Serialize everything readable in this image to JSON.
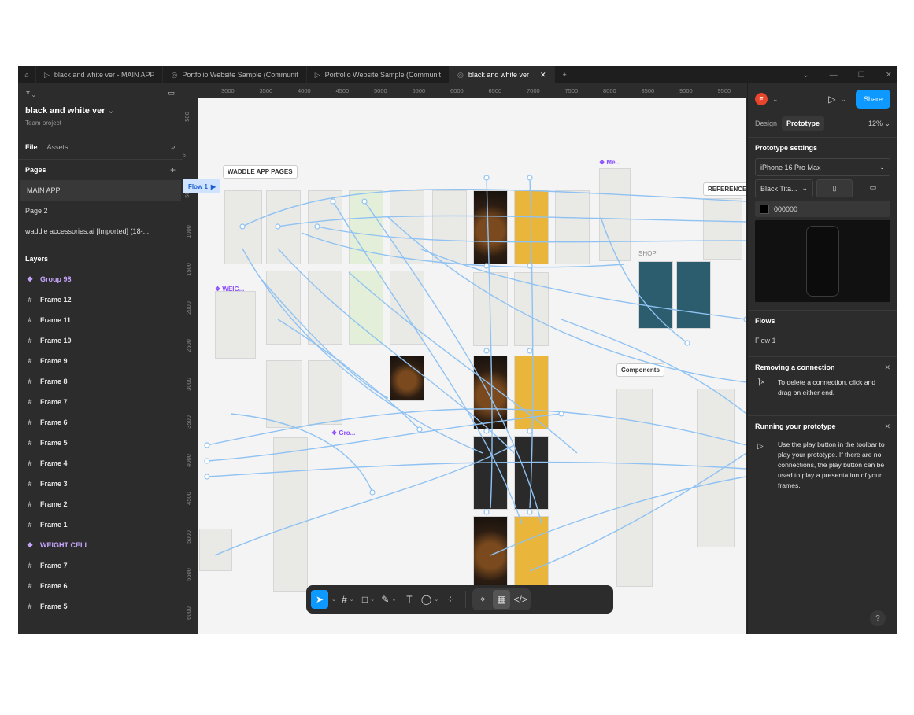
{
  "tabs": [
    {
      "label": "black and white ver - MAIN APP",
      "icon": "play-icon"
    },
    {
      "label": "Portfolio Website Sample (Communit",
      "icon": "figma-icon"
    },
    {
      "label": "Portfolio Website Sample (Communit",
      "icon": "play-icon"
    },
    {
      "label": "black and white ver",
      "icon": "figma-icon",
      "active": true
    }
  ],
  "left_panel": {
    "project_name": "black and white ver",
    "project_team": "Team project",
    "tab_file": "File",
    "tab_assets": "Assets",
    "pages_title": "Pages",
    "pages": [
      "MAIN APP",
      "Page 2",
      "waddle accessories.ai [Imported] (18-..."
    ],
    "layers_title": "Layers",
    "layers": [
      {
        "name": "Group 98",
        "type": "component"
      },
      {
        "name": "Frame 12",
        "type": "frame"
      },
      {
        "name": "Frame 11",
        "type": "frame"
      },
      {
        "name": "Frame 10",
        "type": "frame"
      },
      {
        "name": "Frame 9",
        "type": "frame"
      },
      {
        "name": "Frame 8",
        "type": "frame"
      },
      {
        "name": "Frame 7",
        "type": "frame"
      },
      {
        "name": "Frame 6",
        "type": "frame"
      },
      {
        "name": "Frame 5",
        "type": "frame"
      },
      {
        "name": "Frame 4",
        "type": "frame"
      },
      {
        "name": "Frame 3",
        "type": "frame"
      },
      {
        "name": "Frame 2",
        "type": "frame"
      },
      {
        "name": "Frame 1",
        "type": "frame"
      },
      {
        "name": "WEIGHT CELL",
        "type": "component"
      },
      {
        "name": "Frame 7",
        "type": "frame"
      },
      {
        "name": "Frame 6",
        "type": "frame"
      },
      {
        "name": "Frame 5",
        "type": "frame"
      }
    ]
  },
  "canvas": {
    "ruler_top": [
      "3000",
      "3500",
      "4000",
      "4500",
      "5000",
      "5500",
      "6000",
      "6500",
      "7000",
      "7500",
      "8000",
      "8500",
      "9000",
      "9500"
    ],
    "ruler_left": [
      "500",
      "0",
      "500",
      "1000",
      "1500",
      "2000",
      "2500",
      "3000",
      "3500",
      "4000",
      "4500",
      "5000",
      "5500",
      "6000"
    ],
    "labels": {
      "waddle_pages": "WADDLE APP PAGES",
      "reference": "REFERENCE",
      "components": "Components",
      "shop": "SHOP",
      "weight": "WEIG...",
      "group": "Gro...",
      "me": "Me..."
    },
    "flow_tag": "Flow 1"
  },
  "toolbar": {
    "tools": [
      "move-tool",
      "frame-tool",
      "shape-tool",
      "pen-tool",
      "text-tool",
      "comment-tool",
      "actions-tool"
    ],
    "text_glyph": "T"
  },
  "right_panel": {
    "avatar_letter": "E",
    "share_label": "Share",
    "tab_design": "Design",
    "tab_prototype": "Prototype",
    "zoom": "12%",
    "proto_settings_title": "Prototype settings",
    "device": "iPhone 16 Pro Max",
    "color_model": "Black Tita...",
    "bg_color": "000000",
    "flows_title": "Flows",
    "flow_item": "Flow 1",
    "remove_title": "Removing a connection",
    "remove_text": "To delete a connection, click and drag on either end.",
    "run_title": "Running your prototype",
    "run_text": "Use the play button in the toolbar to play your prototype. If there are no connections, the play button can be used to play a presentation of your frames.",
    "help": "?"
  },
  "colors": {
    "accent": "#0d99ff",
    "component": "#c7a6ff",
    "wire": "#8fc2f2"
  }
}
